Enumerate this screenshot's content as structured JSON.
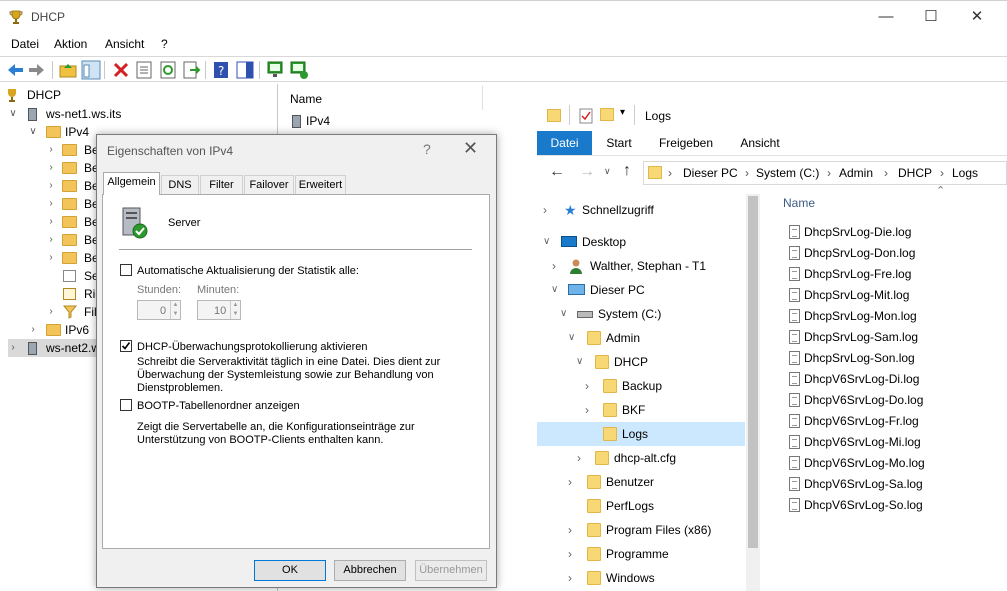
{
  "mmc": {
    "title": "DHCP",
    "menu": [
      "Datei",
      "Aktion",
      "Ansicht",
      "?"
    ],
    "tree": {
      "root": "DHCP",
      "server1": "ws-net1.ws.its",
      "ipv4": "IPv4",
      "ipv4_children": [
        "Be",
        "Be",
        "Be",
        "Be",
        "Be",
        "Be",
        "Be",
        "Se",
        "Ric",
        "Fil"
      ],
      "ipv6": "IPv6",
      "server2": "ws-net2.ws"
    },
    "list": {
      "column": "Name",
      "items": [
        "IPv4"
      ]
    }
  },
  "dialog": {
    "title": "Eigenschaften von IPv4",
    "help": "?",
    "tabs": [
      "Allgemein",
      "DNS",
      "Filter",
      "Failover",
      "Erweitert"
    ],
    "server_label": "Server",
    "auto_update_label": "Automatische Aktualisierung der Statistik alle:",
    "hours_label": "Stunden:",
    "hours_value": "0",
    "minutes_label": "Minuten:",
    "minutes_value": "10",
    "audit_label": "DHCP-Überwachungsprotokollierung aktivieren",
    "audit_desc_1": "Schreibt die Serveraktivität täglich in eine Datei. Dies dient zur",
    "audit_desc_2": "Überwachung der Systemleistung sowie zur Behandlung von",
    "audit_desc_3": "Dienstproblemen.",
    "bootp_label": "BOOTP-Tabellenordner anzeigen",
    "bootp_desc_1": "Zeigt die Servertabelle an, die Konfigurationseinträge zur",
    "bootp_desc_2": "Unterstützung von BOOTP-Clients enthalten kann.",
    "ok": "OK",
    "cancel": "Abbrechen",
    "apply": "Übernehmen"
  },
  "explorer": {
    "title": "Logs",
    "ribbon_tabs": [
      "Datei",
      "Start",
      "Freigeben",
      "Ansicht"
    ],
    "breadcrumb": [
      "Dieser PC",
      "System (C:)",
      "Admin",
      "DHCP",
      "Logs"
    ],
    "nav": [
      "Schnellzugriff",
      "Desktop",
      "Walther, Stephan - T1",
      "Dieser PC",
      "System (C:)",
      "Admin",
      "DHCP",
      "Backup",
      "BKF",
      "Logs",
      "dhcp-alt.cfg",
      "Benutzer",
      "PerfLogs",
      "Program Files (x86)",
      "Programme",
      "Windows"
    ],
    "column": "Name",
    "files": [
      "DhcpSrvLog-Die.log",
      "DhcpSrvLog-Don.log",
      "DhcpSrvLog-Fre.log",
      "DhcpSrvLog-Mit.log",
      "DhcpSrvLog-Mon.log",
      "DhcpSrvLog-Sam.log",
      "DhcpSrvLog-Son.log",
      "DhcpV6SrvLog-Di.log",
      "DhcpV6SrvLog-Do.log",
      "DhcpV6SrvLog-Fr.log",
      "DhcpV6SrvLog-Mi.log",
      "DhcpV6SrvLog-Mo.log",
      "DhcpV6SrvLog-Sa.log",
      "DhcpV6SrvLog-So.log"
    ]
  },
  "colors": {
    "accent": "#0078d7",
    "selection": "#cce8ff",
    "folder": "#f8d775"
  }
}
